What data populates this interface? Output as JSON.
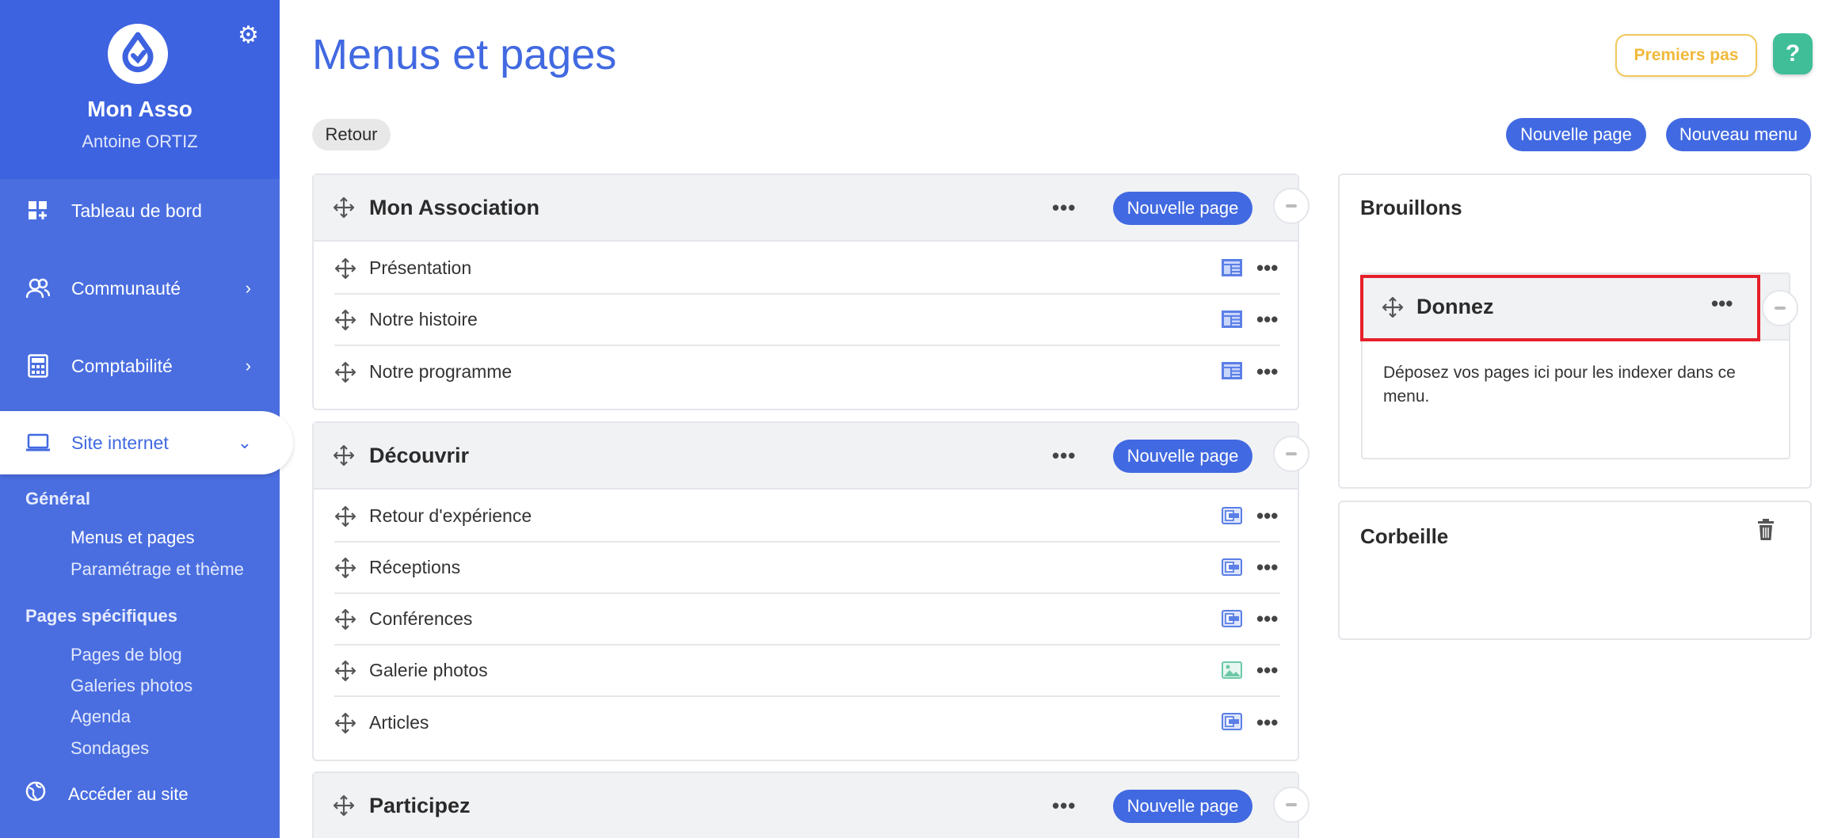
{
  "sidebar": {
    "org_name": "Mon Asso",
    "user_name": "Antoine ORTIZ",
    "nav": [
      {
        "label": "Tableau de bord",
        "icon": "dashboard-icon"
      },
      {
        "label": "Communauté",
        "icon": "community-icon",
        "chevron": "›"
      },
      {
        "label": "Comptabilité",
        "icon": "calculator-icon",
        "chevron": "›"
      },
      {
        "label": "Site internet",
        "icon": "laptop-icon",
        "chevron": "⌄",
        "active": true
      }
    ],
    "general_title": "Général",
    "general_links": [
      "Menus et pages",
      "Paramétrage et thème"
    ],
    "specific_title": "Pages spécifiques",
    "specific_links": [
      "Pages de blog",
      "Galeries photos",
      "Agenda",
      "Sondages"
    ],
    "access_site": "Accéder au site"
  },
  "header": {
    "title": "Menus et pages",
    "premiers_pas": "Premiers pas",
    "help": "?",
    "retour": "Retour",
    "new_page": "Nouvelle page",
    "new_menu": "Nouveau menu"
  },
  "menus": [
    {
      "title": "Mon Association",
      "button": "Nouvelle page",
      "pages": [
        {
          "label": "Présentation",
          "icon": "layout-page-icon"
        },
        {
          "label": "Notre histoire",
          "icon": "layout-page-icon"
        },
        {
          "label": "Notre programme",
          "icon": "layout-page-icon"
        }
      ]
    },
    {
      "title": "Découvrir",
      "button": "Nouvelle page",
      "pages": [
        {
          "label": "Retour d'expérience",
          "icon": "article-page-icon"
        },
        {
          "label": "Réceptions",
          "icon": "article-page-icon"
        },
        {
          "label": "Conférences",
          "icon": "article-page-icon"
        },
        {
          "label": "Galerie photos",
          "icon": "image-page-icon"
        },
        {
          "label": "Articles",
          "icon": "article-page-icon"
        }
      ]
    },
    {
      "title": "Participez",
      "button": "Nouvelle page",
      "pages": []
    }
  ],
  "drafts": {
    "title": "Brouillons",
    "menu_title": "Donnez",
    "hint": "Déposez vos pages ici pour les indexer dans ce menu."
  },
  "trash": {
    "title": "Corbeille"
  },
  "colors": {
    "primary": "#4169e1",
    "sidebar": "#4a6ee0",
    "help_green": "#3fbe98",
    "premiers_yellow": "#f0b93a",
    "highlight_red": "#e5202b"
  }
}
